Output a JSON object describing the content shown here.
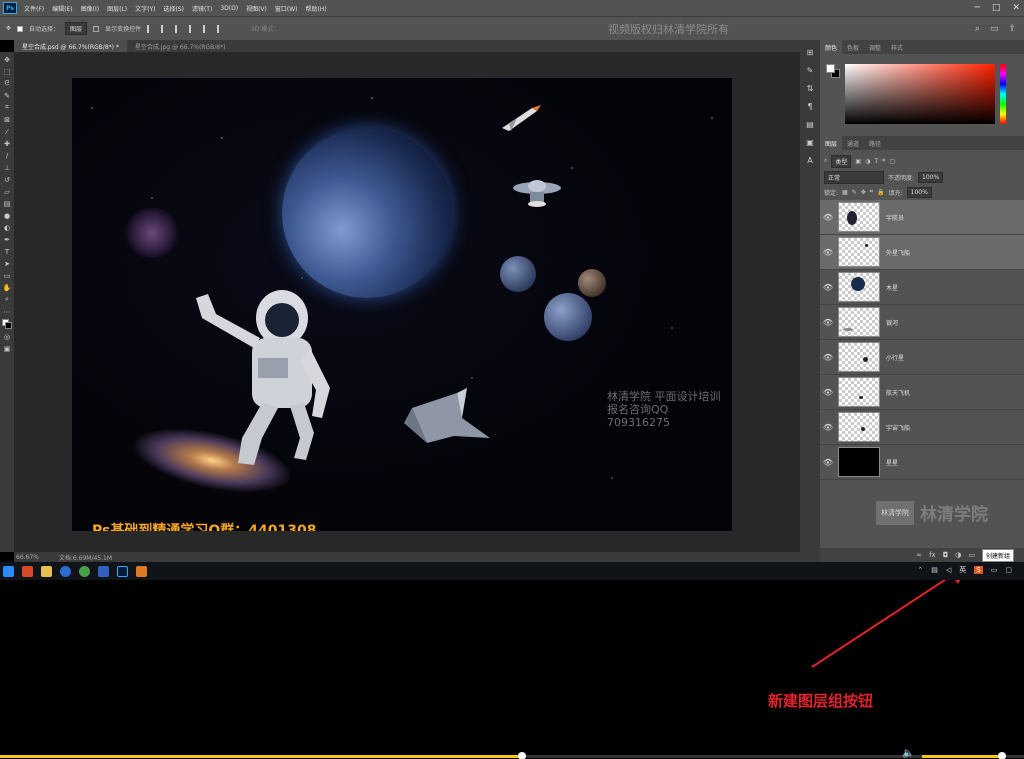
{
  "menubar": {
    "items": [
      "文件(F)",
      "编辑(E)",
      "图像(I)",
      "图层(L)",
      "文字(Y)",
      "选择(S)",
      "滤镜(T)",
      "3D(D)",
      "视图(V)",
      "窗口(W)",
      "帮助(H)"
    ],
    "logo": "Ps",
    "window_controls": [
      "─",
      "□",
      "✕"
    ]
  },
  "options": {
    "auto_select_label": "自动选择：",
    "auto_select_value": "图层",
    "show_transform_label": "显示变换控件",
    "mode_3d": "3D 模式："
  },
  "watermark_top": "视频版权归林清学院所有",
  "tabs": [
    {
      "label": "星空合成.psd @ 66.7%(RGB/8*) *",
      "active": true
    },
    {
      "label": "星空合成.jpg @ 66.7%(RGB/8*)",
      "active": false
    }
  ],
  "canvas": {
    "watermark_line1": "林清学院  平面设计培训",
    "watermark_line2": "报名咨询QQ 709316275",
    "qq_group": "Ps基础到精通学习Q群：4401308"
  },
  "status": {
    "zoom": "66.67%",
    "doc": "文档:6.69M/45.1M"
  },
  "color_panel": {
    "tabs": [
      "颜色",
      "色板",
      "调整",
      "样式"
    ],
    "colors": {
      "fg": "#ffffff",
      "bg": "#000000",
      "hue": "#ff2000"
    }
  },
  "layers_panel": {
    "tabs": [
      "图层",
      "通道",
      "路径"
    ],
    "filter_kind": "类型",
    "blend_mode": "正常",
    "opacity_label": "不透明度:",
    "opacity_value": "100%",
    "lock_label": "锁定:",
    "fill_label": "填充:",
    "fill_value": "100%",
    "layers": [
      {
        "name": "宇航员",
        "selected": true
      },
      {
        "name": "外星飞船",
        "selected": true
      },
      {
        "name": "木星",
        "selected": false
      },
      {
        "name": "银河",
        "selected": false
      },
      {
        "name": "小行星",
        "selected": false
      },
      {
        "name": "航天飞机",
        "selected": false
      },
      {
        "name": "宇宙飞船",
        "selected": false
      },
      {
        "name": "星星",
        "selected": false
      }
    ],
    "tooltip": "创建新组"
  },
  "logo_panel": {
    "box": "林清学院",
    "text": "林清学院"
  },
  "taskbar": {
    "tray_lang": "英"
  },
  "annotation": {
    "text": "新建图层组按钮",
    "color": "#e0242a"
  },
  "player": {
    "progress": 0.51,
    "volume": 0.95,
    "accent": "#f5c518"
  }
}
